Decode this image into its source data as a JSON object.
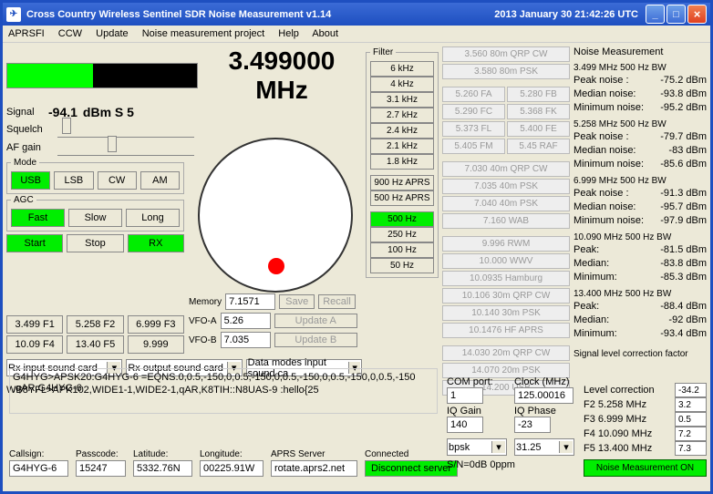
{
  "title": "Cross Country Wireless Sentinel SDR Noise Measurement v1.14",
  "date": "2013 January 30  21:42:26 UTC",
  "menu": {
    "m1": "APRSFI",
    "m2": "CCW",
    "m3": "Update",
    "m4": "Noise measurement project",
    "m5": "Help",
    "m6": "About"
  },
  "freq": "3.499000 MHz",
  "signal": {
    "lbl": "Signal",
    "val": "-94.1",
    "unit": "dBm S 5"
  },
  "squelch": "Squelch",
  "afgain": "AF gain",
  "mode": {
    "legend": "Mode",
    "usb": "USB",
    "lsb": "LSB",
    "cw": "CW",
    "am": "AM"
  },
  "agc": {
    "legend": "AGC",
    "fast": "Fast",
    "slow": "Slow",
    "long": "Long"
  },
  "ctrl": {
    "start": "Start",
    "stop": "Stop",
    "rx": "RX"
  },
  "mem": {
    "lbl": "Memory",
    "val": "7.1571",
    "save": "Save",
    "recall": "Recall"
  },
  "vfoa": {
    "lbl": "VFO-A",
    "val": "5.26",
    "btn": "Update A"
  },
  "vfob": {
    "lbl": "VFO-B",
    "val": "7.035",
    "btn": "Update B"
  },
  "fbtns": {
    "f1": "3.499 F1",
    "f2": "5.258 F2",
    "f3": "6.999 F3",
    "f4": "10.09 F4",
    "f5": "13.40 F5",
    "f6": "9.999"
  },
  "combos": {
    "c1": "Rx input sound card",
    "c2": "Rx output sound card",
    "c3": "Data modes input sound ca"
  },
  "aprs1": "WB8YFL>APK102,WIDE1-1,WIDE2-1,qAR,K8TIH::N8UAS-9 :hello{25",
  "aprs2": "G4HYG>APSK20:G4HYG-6 =EQNS.0,0.5,-150,0,0.5,-150,0,0.5,-150,0,0.5,-150,0,0.5,-150 ,qAR,G4HYG-6",
  "bottom": {
    "callsign": {
      "lbl": "Callsign:",
      "val": "G4HYG-6"
    },
    "passcode": {
      "lbl": "Passcode:",
      "val": "15247"
    },
    "lat": {
      "lbl": "Latitude:",
      "val": "5332.76N"
    },
    "lon": {
      "lbl": "Longitude:",
      "val": "00225.91W"
    },
    "server": {
      "lbl": "APRS Server",
      "val": "rotate.aprs2.net"
    },
    "conn": {
      "lbl": "Connected",
      "btn": "Disconnect server"
    }
  },
  "filter": {
    "legend": "Filter",
    "f1": "6 kHz",
    "f2": "4 kHz",
    "f3": "3.1 kHz",
    "f4": "2.7 kHz",
    "f5": "2.4 kHz",
    "f6": "2.1 kHz",
    "f7": "1.8 kHz",
    "f8": "900 Hz APRS",
    "f9": "500 Hz APRS",
    "f10": "500 Hz",
    "f11": "250 Hz",
    "f12": "100 Hz",
    "f13": "50 Hz"
  },
  "presets": {
    "p1": "3.560 80m QRP CW",
    "p2": "3.580 80m PSK",
    "p3a": "5.260 FA",
    "p3b": "5.280 FB",
    "p4a": "5.290 FC",
    "p4b": "5.368 FK",
    "p5a": "5.373 FL",
    "p5b": "5.400 FE",
    "p6a": "5.405 FM",
    "p6b": "5.45 RAF",
    "p7": "7.030 40m QRP CW",
    "p8": "7.035 40m PSK",
    "p9": "7.040 40m PSK",
    "p10": "7.160 WAB",
    "p11": "9.996 RWM",
    "p12": "10.000 WWV",
    "p13": "10.0935 Hamburg",
    "p14": "10.106 30m QRP CW",
    "p15": "10.140 30m PSK",
    "p16": "10.1476 HF APRS",
    "p17": "14.030 20m QRP CW",
    "p18": "14.070 20m PSK",
    "p19": "14.200 USB"
  },
  "iq": {
    "com": {
      "lbl": "COM port:",
      "val": "1"
    },
    "clock": {
      "lbl": "Clock (MHz)",
      "val": "125.00016"
    },
    "gain": {
      "lbl": "IQ Gain",
      "val": "140"
    },
    "phase": {
      "lbl": "IQ Phase",
      "val": "-23"
    },
    "mode": "bpsk",
    "rate": "31.25",
    "sn": "S/N=0dB    0ppm"
  },
  "nm": {
    "title": "Noise Measurement",
    "b1": {
      "h": "3.499 MHz 500 Hz BW",
      "p": "Peak noise :",
      "pv": "-75.2 dBm",
      "m": "Median noise:",
      "mv": "-93.8 dBm",
      "n": "Minimum noise:",
      "nv": "-95.2 dBm"
    },
    "b2": {
      "h": "5.258 MHz 500 Hz BW",
      "p": "Peak noise :",
      "pv": "-79.7 dBm",
      "m": "Median noise:",
      "mv": "-83 dBm",
      "n": "Minimum noise:",
      "nv": "-85.6 dBm"
    },
    "b3": {
      "h": "6.999 MHz 500 Hz BW",
      "p": "Peak noise :",
      "pv": "-91.3 dBm",
      "m": "Median noise:",
      "mv": "-95.7 dBm",
      "n": "Minimum noise:",
      "nv": "-97.9 dBm"
    },
    "b4": {
      "h": "10.090 MHz 500 Hz BW",
      "p": "Peak:",
      "pv": "-81.5 dBm",
      "m": "Median:",
      "mv": "-83.8 dBm",
      "n": "Minimum:",
      "nv": "-85.3 dBm"
    },
    "b5": {
      "h": "13.400 MHz 500 Hz BW",
      "p": "Peak:",
      "pv": "-88.4 dBm",
      "m": "Median:",
      "mv": "-92 dBm",
      "n": "Minimum:",
      "nv": "-93.4 dBm"
    },
    "corr": {
      "title": "Signal level correction factor",
      "lc": "Level correction",
      "lcv": "-34.2",
      "f2": "F2 5.258 MHz",
      "f2v": "3.2",
      "f3": "F3 6.999 MHz",
      "f3v": "0.5",
      "f4": "F4 10.090 MHz",
      "f4v": "7.2",
      "f5": "F5 13.400 MHz",
      "f5v": "7.3"
    },
    "btn": "Noise Measurement ON"
  }
}
